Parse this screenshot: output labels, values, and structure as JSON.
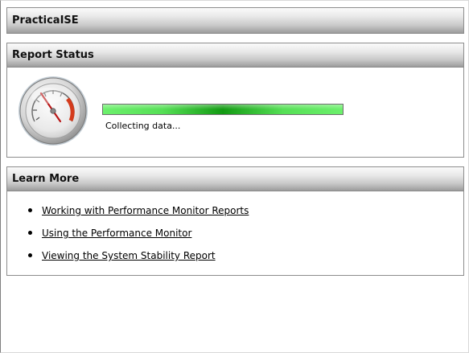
{
  "panels": {
    "top": {
      "title": "PracticaISE"
    },
    "status": {
      "title": "Report Status",
      "progress_fraction": 1.0,
      "progress_text": "Collecting data...",
      "icon": "performance-gauge-icon"
    },
    "learn_more": {
      "title": "Learn More",
      "links": [
        {
          "label": "Working with Performance Monitor Reports"
        },
        {
          "label": "Using the Performance Monitor"
        },
        {
          "label": "Viewing the System Stability Report"
        }
      ]
    }
  },
  "colors": {
    "progress_green": "#5ce65c",
    "progress_dark": "#129a12",
    "gauge_red": "#d43b1c"
  }
}
